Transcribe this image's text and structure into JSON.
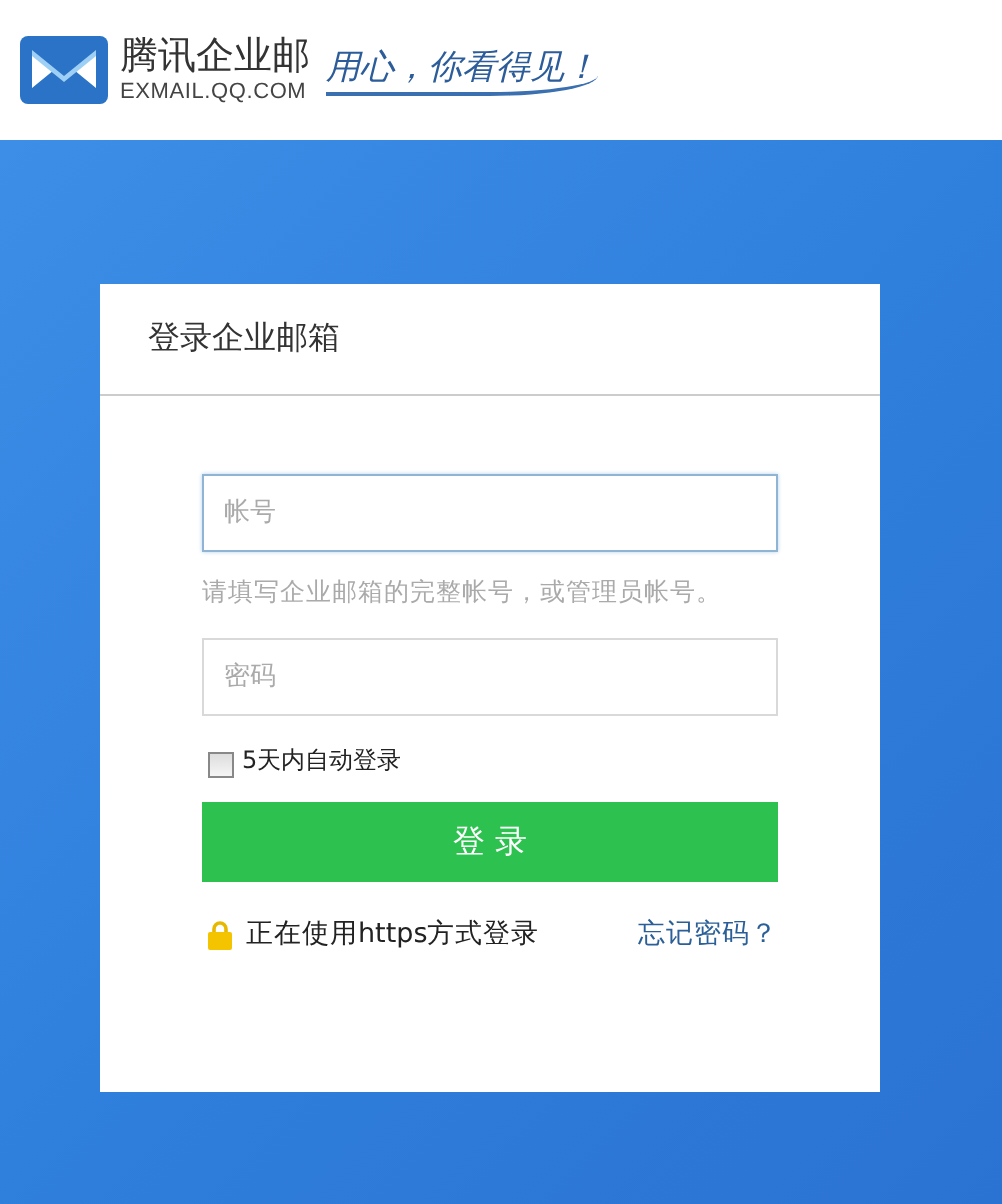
{
  "header": {
    "brand_name": "腾讯企业邮",
    "brand_domain": "EXMAIL.QQ.COM",
    "slogan": "用心，你看得见！"
  },
  "login_card": {
    "title": "登录企业邮箱",
    "account_field": {
      "placeholder": "帐号",
      "focused": true
    },
    "account_hint": "请填写企业邮箱的完整帐号，或管理员帐号。",
    "password_field": {
      "placeholder": "密码",
      "focused": false
    },
    "remember": {
      "label": "5天内自动登录",
      "checked": false
    },
    "login_button": "登 录",
    "secure_note": "正在使用https方式登录",
    "forgot_link": "忘记密码？"
  }
}
